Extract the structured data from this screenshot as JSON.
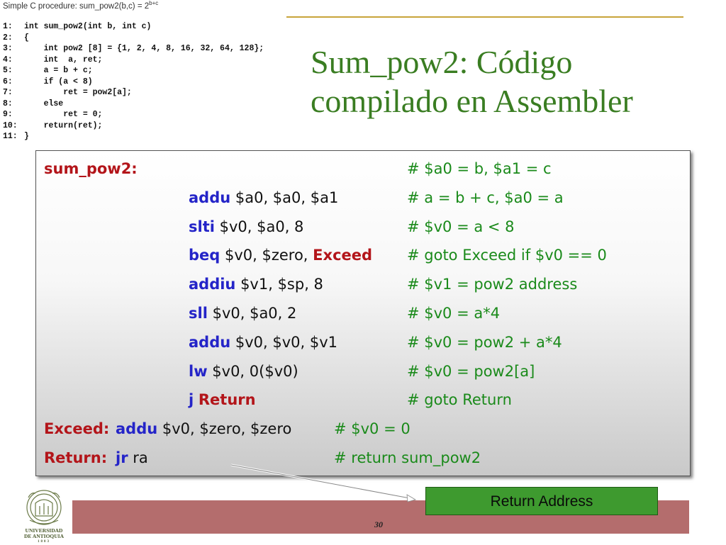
{
  "caption": {
    "text": "Simple C procedure: sum_pow2(b,c) = 2",
    "sup": "b+c"
  },
  "c_code": [
    {
      "n": "1:",
      "text": "int sum_pow2(int b, int c)"
    },
    {
      "n": "2:",
      "text": "{"
    },
    {
      "n": "3:",
      "text": "    int pow2 [8] = {1, 2, 4, 8, 16, 32, 64, 128};"
    },
    {
      "n": "4:",
      "text": "    int  a, ret;"
    },
    {
      "n": "5:",
      "text": "    a = b + c;"
    },
    {
      "n": "6:",
      "text": "    if (a < 8)"
    },
    {
      "n": "7:",
      "text": "        ret = pow2[a];"
    },
    {
      "n": "8:",
      "text": "    else"
    },
    {
      "n": "9:",
      "text": "        ret = 0;"
    },
    {
      "n": "10:",
      "text": "    return(ret);"
    },
    {
      "n": "11:",
      "text": "}"
    }
  ],
  "title": {
    "line1": "Sum_pow2: Código",
    "line2": "compilado en Assembler"
  },
  "asm": {
    "label_start": "sum_pow2:",
    "comment0": "# $a0 = b, $a1 = c",
    "lines": [
      {
        "op": "addu",
        "args": " $a0, $a0, $a1",
        "target": "",
        "comment": "# a = b + c, $a0 = a"
      },
      {
        "op": "slti",
        "args": " $v0, $a0, 8",
        "target": "",
        "comment": "# $v0 = a < 8"
      },
      {
        "op": "beq",
        "args": " $v0, $zero, ",
        "target": "Exceed",
        "comment": "# goto Exceed if $v0 == 0"
      },
      {
        "op": "addiu",
        "args": " $v1, $sp, 8",
        "target": "",
        "comment": "# $v1 = pow2 address"
      },
      {
        "op": "sll",
        "args": " $v0, $a0, 2",
        "target": "",
        "comment": "# $v0 = a*4"
      },
      {
        "op": "addu",
        "args": " $v0, $v0, $v1",
        "target": "",
        "comment": "# $v0 = pow2 + a*4"
      },
      {
        "op": "lw",
        "args": " $v0, 0($v0)",
        "target": "",
        "comment": "# $v0 = pow2[a]"
      },
      {
        "op": "j",
        "args": " ",
        "target": "Return",
        "comment": "# goto Return"
      }
    ],
    "exceed": {
      "label": "Exceed:",
      "op": "addu",
      "args": " $v0, $zero, $zero",
      "comment": "# $v0 = 0"
    },
    "ret": {
      "label": "Return:",
      "op": "jr",
      "args": " ra",
      "comment": "# return sum_pow2"
    }
  },
  "return_box": "Return Address",
  "page_number": "30",
  "logo": {
    "line1": "UNIVERSIDAD",
    "line2": "DE ANTIOQUIA",
    "year": "1803"
  },
  "colors": {
    "title": "#3a7d22",
    "opcode": "#2424c8",
    "label": "#b3151a",
    "comment": "#1a8a1a",
    "footer": "#b46d6d",
    "box": "#3e9a2f"
  }
}
